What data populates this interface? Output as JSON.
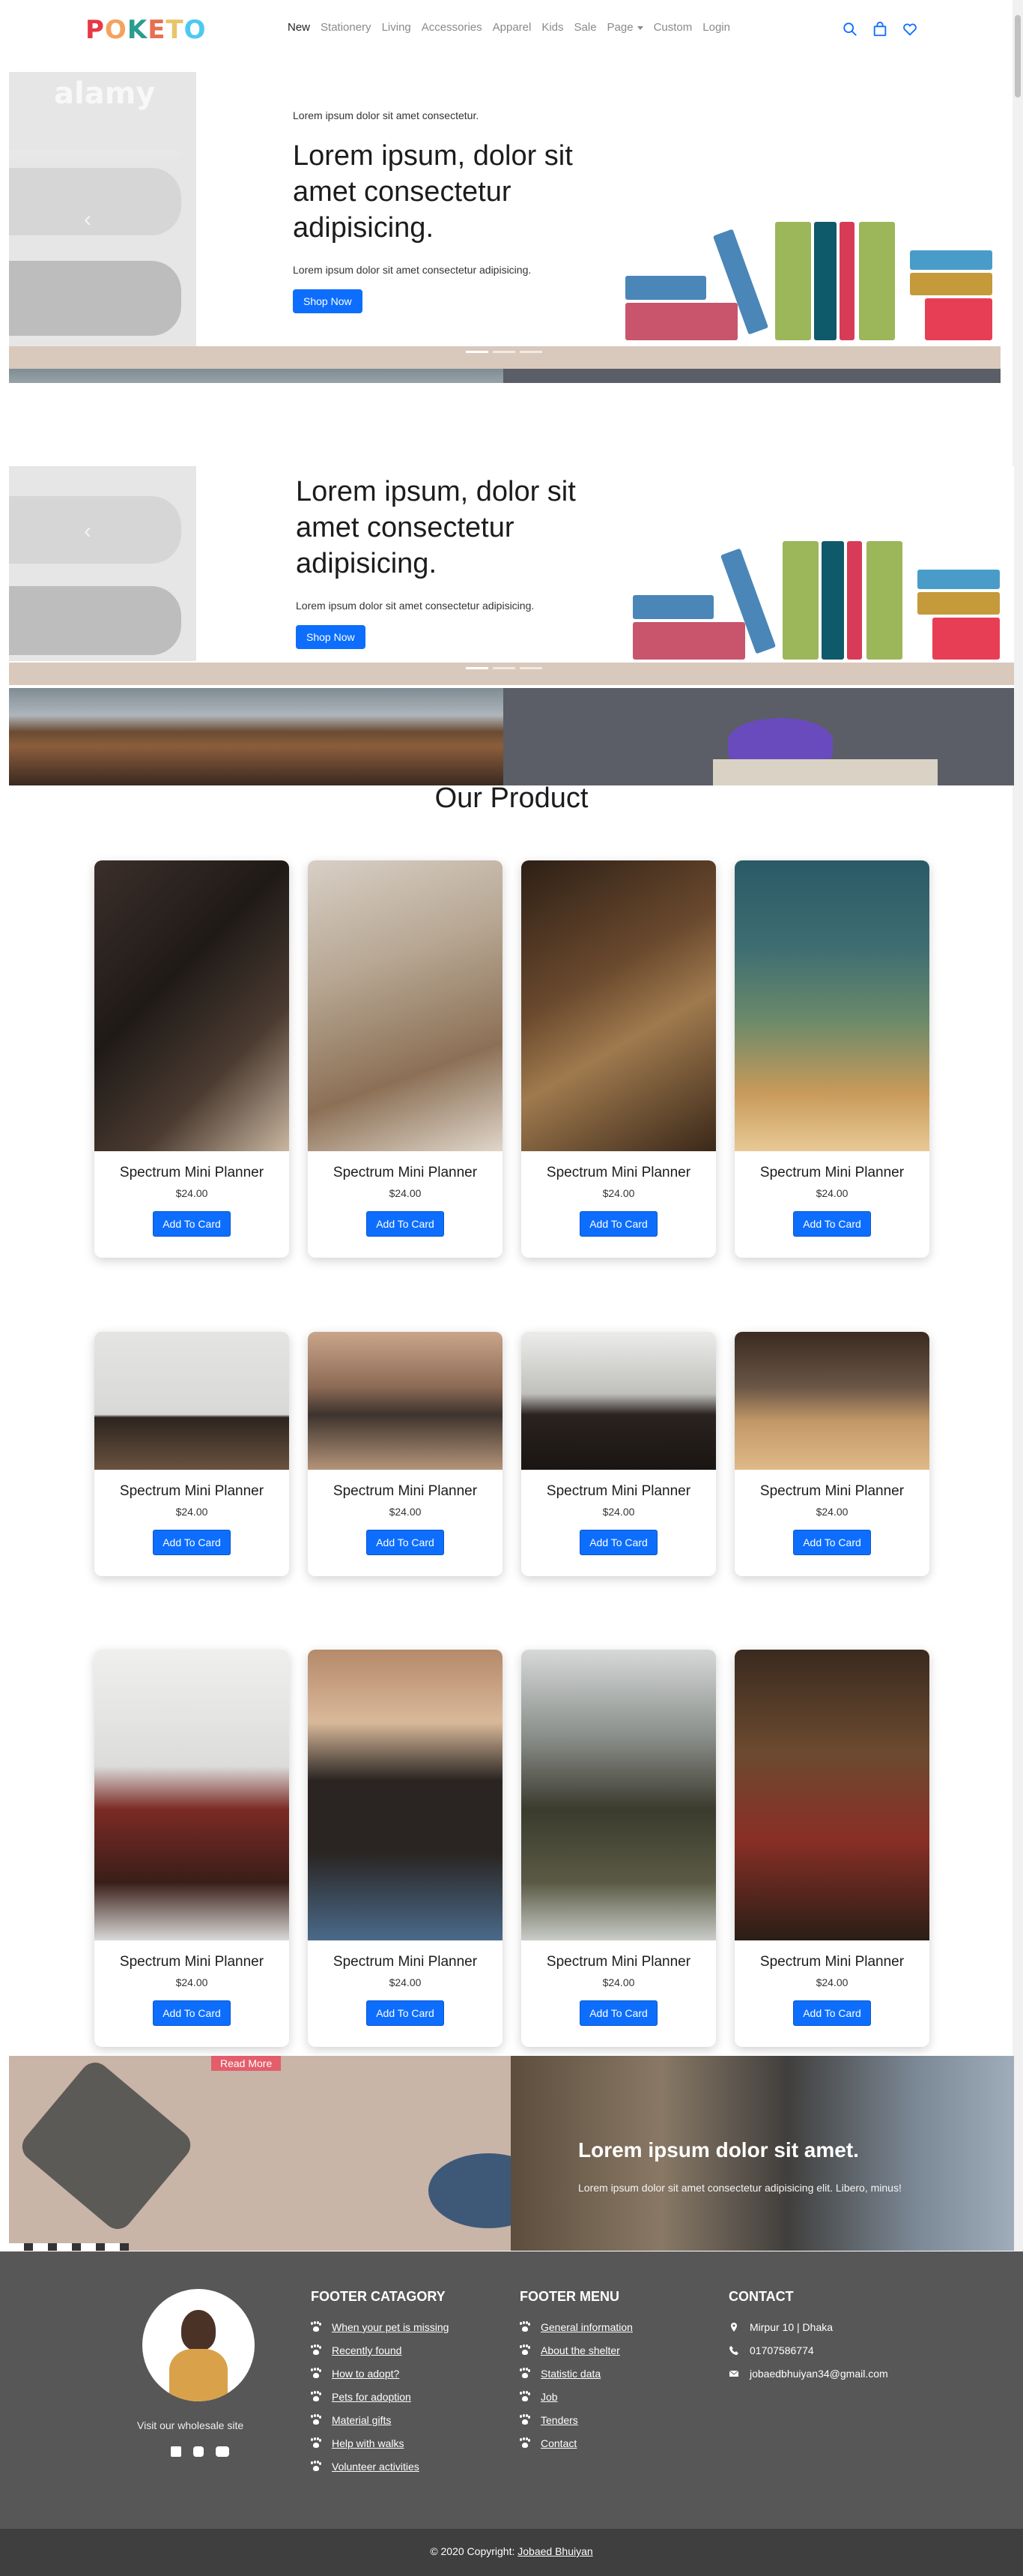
{
  "brand": {
    "logo_letters": [
      "P",
      "O",
      "K",
      "E",
      "T",
      "O"
    ],
    "logo_colors": [
      "#e63946",
      "#f4a261",
      "#2a9d8f",
      "#e76f51",
      "#e9c46a",
      "#4cc9f0"
    ]
  },
  "nav": {
    "items": [
      "New",
      "Stationery",
      "Living",
      "Accessories",
      "Apparel",
      "Kids",
      "Sale",
      "Page",
      "Custom",
      "Login"
    ],
    "active": "New",
    "icons": [
      "search-icon",
      "bag-icon",
      "heart-icon"
    ],
    "accent": "#0d6efd"
  },
  "hero": {
    "eyebrow": "Lorem ipsum dolor sit amet consectetur.",
    "title": "Lorem ipsum, dolor sit amet consectetur adipisicing.",
    "description": "Lorem ipsum dolor sit amet consectetur adipisicing.",
    "cta": "Shop Now",
    "watermark": "alamy"
  },
  "products": {
    "section_title": "Our Product",
    "items": [
      {
        "name": "Spectrum Mini Planner",
        "price": "$24.00",
        "cta": "Add To Card"
      },
      {
        "name": "Spectrum Mini Planner",
        "price": "$24.00",
        "cta": "Add To Card"
      },
      {
        "name": "Spectrum Mini Planner",
        "price": "$24.00",
        "cta": "Add To Card"
      },
      {
        "name": "Spectrum Mini Planner",
        "price": "$24.00",
        "cta": "Add To Card"
      },
      {
        "name": "Spectrum Mini Planner",
        "price": "$24.00",
        "cta": "Add To Card"
      },
      {
        "name": "Spectrum Mini Planner",
        "price": "$24.00",
        "cta": "Add To Card"
      },
      {
        "name": "Spectrum Mini Planner",
        "price": "$24.00",
        "cta": "Add To Card"
      },
      {
        "name": "Spectrum Mini Planner",
        "price": "$24.00",
        "cta": "Add To Card"
      },
      {
        "name": "Spectrum Mini Planner",
        "price": "$24.00",
        "cta": "Add To Card"
      },
      {
        "name": "Spectrum Mini Planner",
        "price": "$24.00",
        "cta": "Add To Card"
      },
      {
        "name": "Spectrum Mini Planner",
        "price": "$24.00",
        "cta": "Add To Card"
      },
      {
        "name": "Spectrum Mini Planner",
        "price": "$24.00",
        "cta": "Add To Card"
      }
    ]
  },
  "promo": {
    "badge": "Read More",
    "title": "Lorem ipsum dolor sit amet.",
    "description": "Lorem ipsum dolor sit amet consectetur adipisicing elit. Libero, minus!"
  },
  "footer": {
    "wholesale": "Visit our wholesale site",
    "social_icons": [
      "facebook-icon",
      "instagram-icon",
      "youtube-icon"
    ],
    "category": {
      "title": "FOOTER CATAGORY",
      "links": [
        "When your pet is missing",
        "Recently found",
        "How to adopt?",
        "Pets for adoption",
        "Material gifts",
        "Help with walks",
        "Volunteer activities"
      ]
    },
    "menu": {
      "title": "FOOTER MENU",
      "links": [
        "General information",
        "About the shelter",
        "Statistic data",
        "Job",
        "Tenders",
        "Contact"
      ]
    },
    "contact": {
      "title": "CONTACT",
      "address": "Mirpur 10 | Dhaka",
      "phone": "01707586774",
      "email": "jobaedbhuiyan34@gmail.com"
    },
    "copyright_prefix": "© 2020 Copyright:",
    "copyright_name": "Jobaed Bhuiyan"
  }
}
